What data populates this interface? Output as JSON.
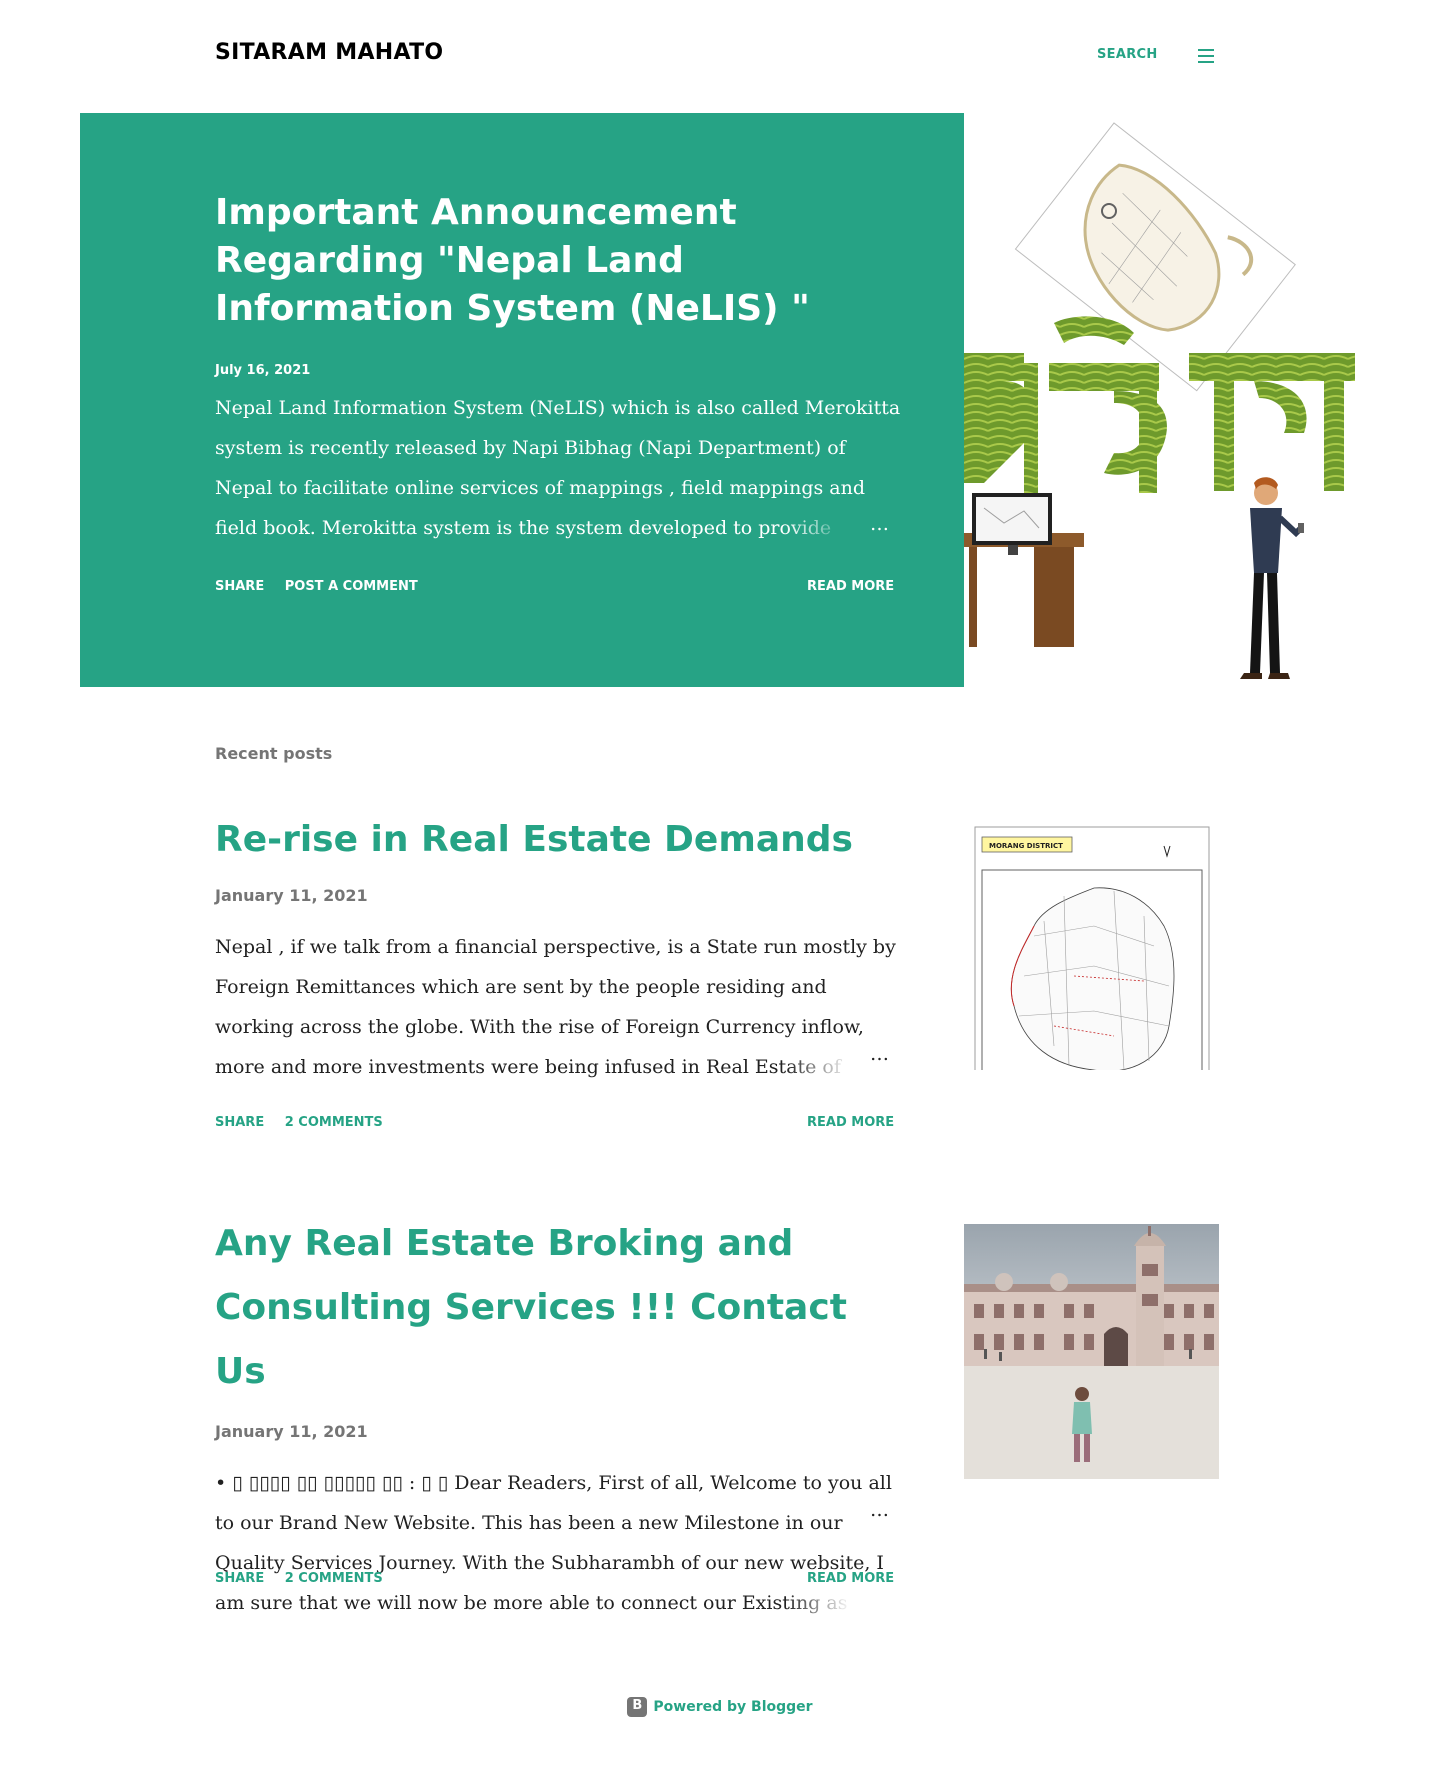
{
  "header": {
    "site_title": "SITARAM MAHATO",
    "search_label": "SEARCH",
    "menu_icon": "hamburger-menu-icon"
  },
  "hero": {
    "title": "Important Announcement Regarding \"Nepal Land Information System (NeLIS) \"",
    "date": "July 16, 2021",
    "snippet": "  Nepal Land Information System (NeLIS) which is also called Merokitta system is recently released by Napi Bibhag (Napi Department) of Nepal to facilitate online services of mappings , field mappings and field book. Merokitta system is the system developed to provide services of Napi",
    "ellipsis": "…",
    "share_label": "SHARE",
    "comment_label": "POST A COMMENT",
    "read_more_label": "READ MORE",
    "bg_color": "#26a385"
  },
  "recent": {
    "label": "Recent posts"
  },
  "posts": [
    {
      "title": "Re-rise in Real Estate Demands",
      "date": "January 11, 2021",
      "snippet": "Nepal , if we talk from a financial perspective, is a State run mostly by Foreign Remittances which are sent by the people residing and working across the globe. With the rise of Foreign Currency inflow, more and more investments were being infused in Real Estate of Nepal, more",
      "ellipsis": "…",
      "share_label": "SHARE",
      "comments_label": "2 COMMENTS",
      "read_more_label": "READ MORE",
      "thumb_label": "MORANG DISTRICT"
    },
    {
      "title": "Any Real Estate Broking and Consulting Services !!! Contact Us",
      "date": "January 11, 2021",
      "snippet": "• ▯  ▯▯▯▯  ▯▯  ▯▯▯▯▯  ▯▯ : ▯ ▯ Dear Readers, First of all, Welcome to you all to our Brand New Website. This has been a new Milestone in our Quality Services Journey. With the Subharambh of our new website, I am sure that we will now be more able to connect our Existing as well",
      "ellipsis": "…",
      "share_label": "SHARE",
      "comments_label": "2 COMMENTS",
      "read_more_label": "READ MORE"
    }
  ],
  "footer": {
    "powered_by": "Powered by Blogger"
  },
  "colors": {
    "accent": "#26a385",
    "text": "#212121",
    "muted": "#757575"
  }
}
